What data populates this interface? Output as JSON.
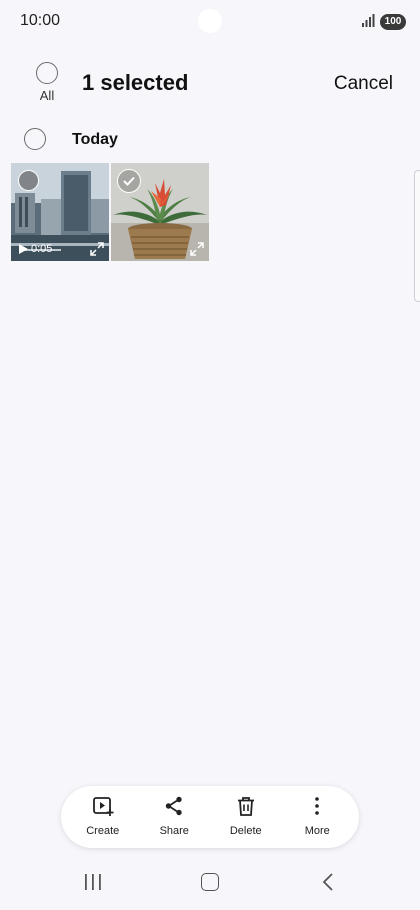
{
  "status_bar": {
    "time": "10:00",
    "battery": "100"
  },
  "header": {
    "select_all_label": "All",
    "title": "1 selected",
    "cancel_label": "Cancel"
  },
  "section": {
    "title": "Today"
  },
  "items": [
    {
      "type": "video",
      "duration": "0:05",
      "selected": false
    },
    {
      "type": "photo",
      "selected": true
    }
  ],
  "toolbar": {
    "create_label": "Create",
    "share_label": "Share",
    "delete_label": "Delete",
    "more_label": "More"
  }
}
